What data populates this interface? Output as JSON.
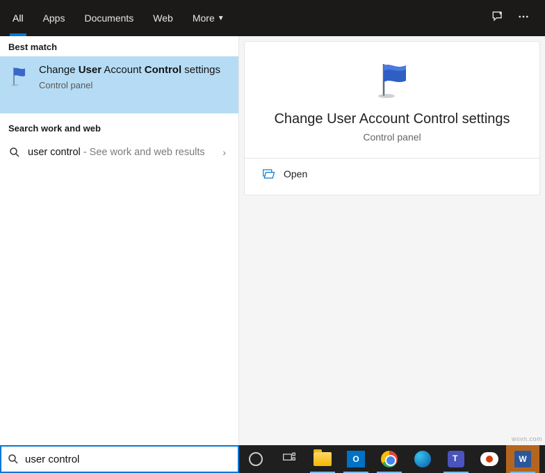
{
  "tabs": {
    "all": "All",
    "apps": "Apps",
    "documents": "Documents",
    "web": "Web",
    "more": "More"
  },
  "sections": {
    "best_match": "Best match",
    "search_work_web": "Search work and web"
  },
  "result": {
    "title_pre": "Change ",
    "title_b1": "User",
    "title_mid": " Account ",
    "title_b2": "Control",
    "title_post": " settings",
    "subtitle": "Control panel"
  },
  "suggestion": {
    "query": "user control",
    "suffix": " - See work and web results"
  },
  "preview": {
    "title": "Change User Account Control settings",
    "subtitle": "Control panel",
    "actions": {
      "open": "Open"
    }
  },
  "search": {
    "value": "user control"
  },
  "watermark": "wsvn.com",
  "icons": {
    "chat": "chat-icon",
    "more": "more-icon"
  }
}
